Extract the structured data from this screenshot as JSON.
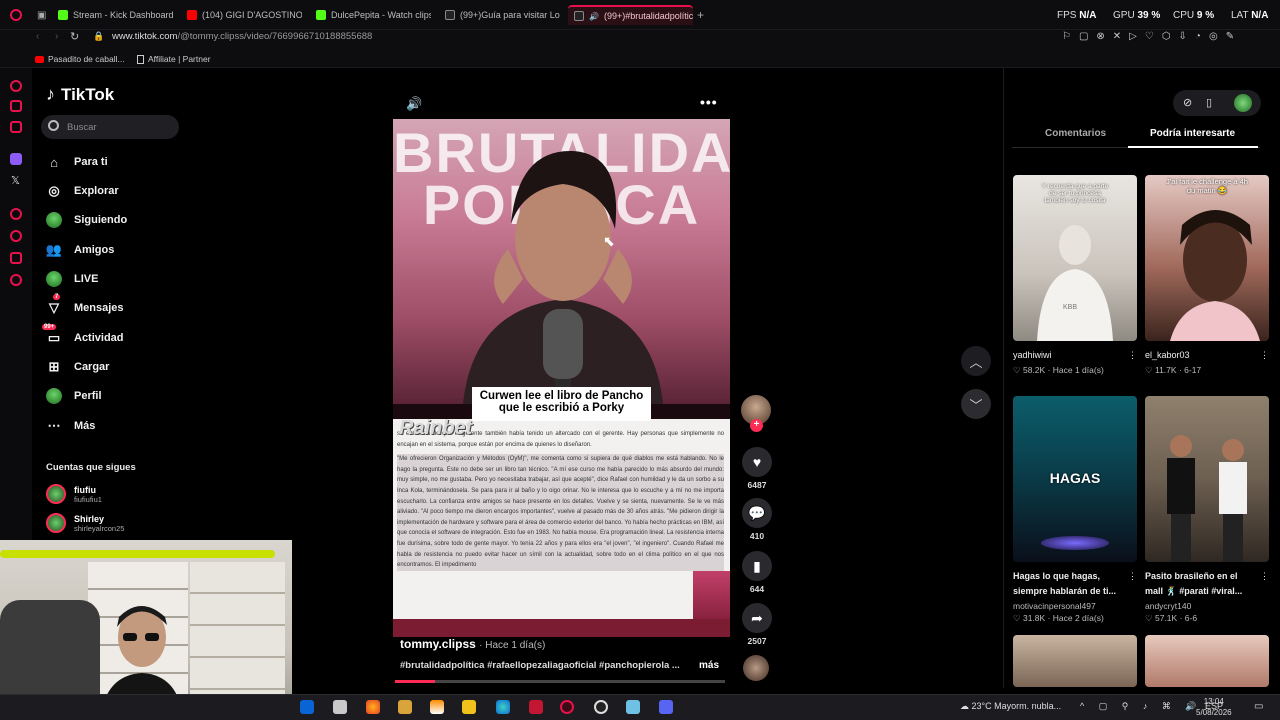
{
  "browser": {
    "tabs": [
      {
        "label": "Stream - Kick Dashboard",
        "color": "#53fc18"
      },
      {
        "label": "(104) GIGI D'AGOSTINO - I",
        "color": "#ff0000"
      },
      {
        "label": "DulcePepita - Watch clips",
        "color": "#53fc18"
      },
      {
        "label": "(99+)Guía para visitar Lom",
        "color": "#ffffff"
      },
      {
        "label": "(99+)#brutalidadpolític",
        "color": "#ffffff"
      }
    ],
    "stats": {
      "fps_label": "FPS",
      "fps_value": "N/A",
      "gpu_label": "GPU",
      "gpu_value": "39 %",
      "cpu_label": "CPU",
      "cpu_value": "9 %",
      "lat_label": "LAT",
      "lat_value": "N/A"
    },
    "url_host": "www.tiktok.com",
    "url_path": "/@tommy.clipss/video/7669966710188855688",
    "bookmarks": [
      "Pasadito de caball...",
      "Affiliate | Partner"
    ]
  },
  "sidebar": {
    "logo": "TikTok",
    "search_placeholder": "Buscar",
    "nav": [
      {
        "label": "Para ti",
        "icon": "home-icon"
      },
      {
        "label": "Explorar",
        "icon": "compass-icon"
      },
      {
        "label": "Siguiendo",
        "icon": "avatar"
      },
      {
        "label": "Amigos",
        "icon": "friends-icon"
      },
      {
        "label": "LIVE",
        "icon": "avatar"
      },
      {
        "label": "Mensajes",
        "icon": "inbox-icon",
        "badge": "7"
      },
      {
        "label": "Actividad",
        "icon": "activity-icon",
        "badge": "99+"
      },
      {
        "label": "Cargar",
        "icon": "upload-icon"
      },
      {
        "label": "Perfil",
        "icon": "avatar"
      },
      {
        "label": "Más",
        "icon": "more-icon"
      }
    ],
    "following_title": "Cuentas que sigues",
    "following": [
      {
        "name": "fiufiu",
        "handle": "fiufiufiu1"
      },
      {
        "name": "Shirley",
        "handle": "shirleyalrcon25"
      }
    ]
  },
  "video": {
    "banner_text": "BRUTALIDAD POLÍTICA",
    "caption_line1": "Curwen lee el libro de Pancho",
    "caption_line2": "que le escribió a Porky",
    "watermark": "Rainbet",
    "doc_paragraphs": [
      "se enteraría de que el gerente también había tenido un altercado con el gerente. Hay personas que simplemente no encajan en el sistema, porque están por encima de quienes lo diseñaron.",
      "\"Me ofrecieron Organización y Métodos (OyM)\", me comenta como si supiera de qué diablos me está hablando. No le hago la pregunta. Este no debe ser un libro tan técnico. \"A mí ese curso me había parecido lo más absurdo del mundo: muy simple, no me gustaba. Pero yo necesitaba trabajar, así que acepté\", dice Rafael con humildad y le da un sorbo a su Inca Kola, terminándosela. Se para para ir al baño y lo oigo orinar. No le interesa que lo escuche y a mí no me importa escucharlo. La confianza entre amigos se hace presente en los detalles. Vuelve y se sienta, nuevamente. Se le ve más aliviado. \"Al poco tiempo me dieron encargos importantes\", vuelve al pasado más de 30 años atrás. \"Me pidieron dirigir la implementación de hardware y software para el área de comercio exterior del banco. Yo había hecho prácticas en IBM, así que conocía el software de integración. Esto fue en 1983. No había mouse. Era programación lineal. La resistencia interna fue durísima, sobre todo de gente mayor. Yo tenía 22 años y para ellos era \"el joven\", \"el ingeniero\". Cuando Rafael me habla de resistencia no puedo evitar hacer un símil con la actualidad, sobre todo en el clima político en el que nos encontramos. El impedimento"
    ],
    "author": "tommy.clipss",
    "posted": "· Hace 1 día(s)",
    "tags": "#brutalidadpolítica #rafaellopezaliagaoficial #panchopierola ...",
    "more": "más",
    "progress": 0.12,
    "actions": {
      "likes": "6487",
      "comments": "410",
      "saves": "644",
      "shares": "2507"
    }
  },
  "right_panel": {
    "tabs": [
      "Comentarios",
      "Podría interesarte"
    ],
    "active_tab": 1,
    "cards": [
      {
        "user": "yadhiwiwi",
        "likes": "58.2K",
        "meta": "Hace 1 día(s)",
        "overlay": "Y recuerda que a parte de ser tu princesa también soy tu cosita",
        "bg": "linear-gradient(180deg,#e9e6e1,#c9c3bb 60%,#8f8a82)"
      },
      {
        "user": "el_kabor03",
        "likes": "11.7K",
        "meta": "6-17",
        "overlay": "J'ai fait le challenge à 4h du matin 😂",
        "bg": "linear-gradient(180deg,#e5c9c4,#a26a5c 55%,#3a241d)"
      },
      {
        "title": "Hagas lo que hagas, siempre hablarán de ti...",
        "user": "motivacinpersonal497",
        "likes": "31.8K",
        "meta": "Hace 2 día(s)",
        "overlay": "HAGAS",
        "bg": "linear-gradient(180deg,#0c5d6b,#0a3a47 50%,#0a0f1a)"
      },
      {
        "title": "Pasito brasileño en el mall 🕺 #parati #viral...",
        "user": "andycryt140",
        "likes": "57.1K",
        "meta": "6-6",
        "overlay": "",
        "bg": "linear-gradient(180deg,#8f806d,#6d5f51 50%,#2f2822)"
      }
    ]
  },
  "taskbar": {
    "weather": "23°C  Mayorm. nubla...",
    "lang": "ESP",
    "time": "13:04",
    "date": "5/08/2026"
  }
}
